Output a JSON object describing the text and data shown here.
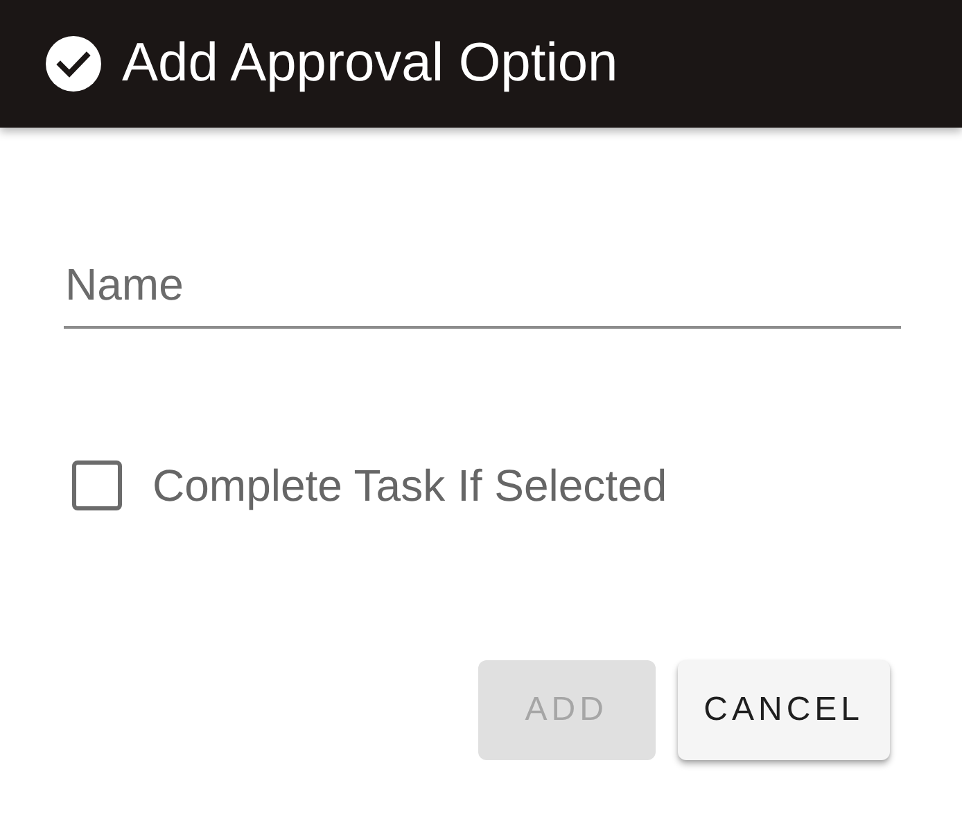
{
  "dialog": {
    "title": "Add Approval Option"
  },
  "name_field": {
    "placeholder": "Name"
  },
  "checkbox": {
    "label": "Complete Task If Selected",
    "checked": false
  },
  "buttons": [
    {
      "label": "ADD",
      "disabled": true
    },
    {
      "label": "CANCEL",
      "disabled": false
    }
  ]
}
